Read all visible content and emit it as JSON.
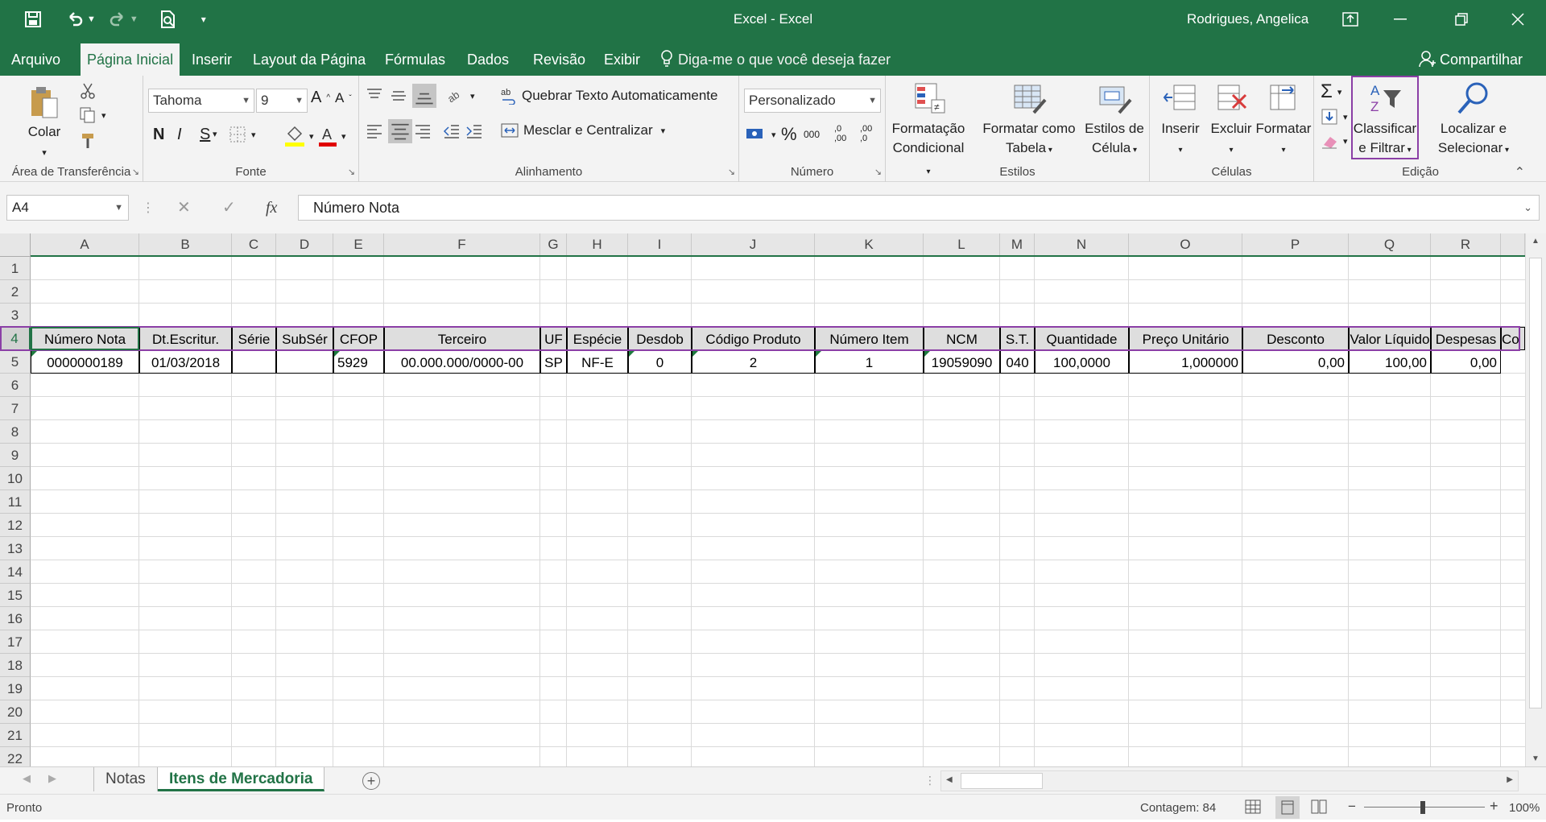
{
  "window": {
    "title": "Excel  -  Excel",
    "user": "Rodrigues, Angelica"
  },
  "tabs": [
    "Arquivo",
    "Página Inicial",
    "Inserir",
    "Layout da Página",
    "Fórmulas",
    "Dados",
    "Revisão",
    "Exibir"
  ],
  "tell_me": "Diga-me o que você deseja fazer",
  "share": "Compartilhar",
  "ribbon": {
    "clipboard": {
      "label": "Área de Transferência",
      "paste": "Colar"
    },
    "font": {
      "label": "Fonte",
      "name": "Tahoma",
      "size": "9",
      "bold": "N",
      "italic": "I",
      "underline": "S",
      "grow": "A",
      "shrink": "A"
    },
    "alignment": {
      "label": "Alinhamento",
      "wrap": "Quebrar Texto Automaticamente",
      "merge": "Mesclar e Centralizar"
    },
    "number": {
      "label": "Número",
      "format": "Personalizado",
      "percent": "%",
      "thousands": "000",
      "inc_dec": ",0 ,00",
      "dec_dec": ",00 ,0"
    },
    "styles": {
      "label": "Estilos",
      "cond1": "Formatação",
      "cond2": "Condicional",
      "table1": "Formatar como",
      "table2": "Tabela",
      "cell1": "Estilos de",
      "cell2": "Célula"
    },
    "cells": {
      "label": "Células",
      "insert": "Inserir",
      "delete": "Excluir",
      "format": "Formatar"
    },
    "editing": {
      "label": "Edição",
      "sort1": "Classificar",
      "sort2": "e Filtrar",
      "find1": "Localizar e",
      "find2": "Selecionar",
      "sigma": "Σ",
      "sort_a": "A",
      "sort_z": "Z"
    }
  },
  "formula_bar": {
    "name_box": "A4",
    "cancel": "✕",
    "enter": "✓",
    "fx": "fx",
    "content": "Número Nota"
  },
  "columns": [
    "A",
    "B",
    "C",
    "D",
    "E",
    "F",
    "G",
    "H",
    "I",
    "J",
    "K",
    "L",
    "M",
    "N",
    "O",
    "P",
    "Q",
    "R"
  ],
  "rows": [
    "1",
    "2",
    "3",
    "4",
    "5",
    "6",
    "7",
    "8",
    "9",
    "10",
    "11",
    "12",
    "13",
    "14",
    "15",
    "16",
    "17",
    "18",
    "19",
    "20",
    "21",
    "22"
  ],
  "header_row": [
    "Número Nota",
    "Dt.Escritur.",
    "Série",
    "SubSér",
    "CFOP",
    "Terceiro",
    "UF",
    "Espécie",
    "Desdob",
    "Código Produto",
    "Número Item",
    "NCM",
    "S.T.",
    "Quantidade",
    "Preço Unitário",
    "Desconto",
    "Valor Líquido",
    "Despesas",
    "Co"
  ],
  "data_row": [
    "0000000189",
    "01/03/2018",
    "",
    "",
    "5929",
    "00.000.000/0000-00",
    "SP",
    "NF-E",
    "0",
    "2",
    "1",
    "19059090",
    "040",
    "100,0000",
    "1,000000",
    "0,00",
    "100,00",
    "0,00"
  ],
  "sheets": [
    "Notas",
    "Itens de Mercadoria"
  ],
  "status": {
    "ready": "Pronto",
    "count": "Contagem: 84",
    "zoom": "100%",
    "minus": "−",
    "plus": "+"
  },
  "colors": {
    "excel_green": "#217346",
    "highlight": "#8b3fa6"
  }
}
